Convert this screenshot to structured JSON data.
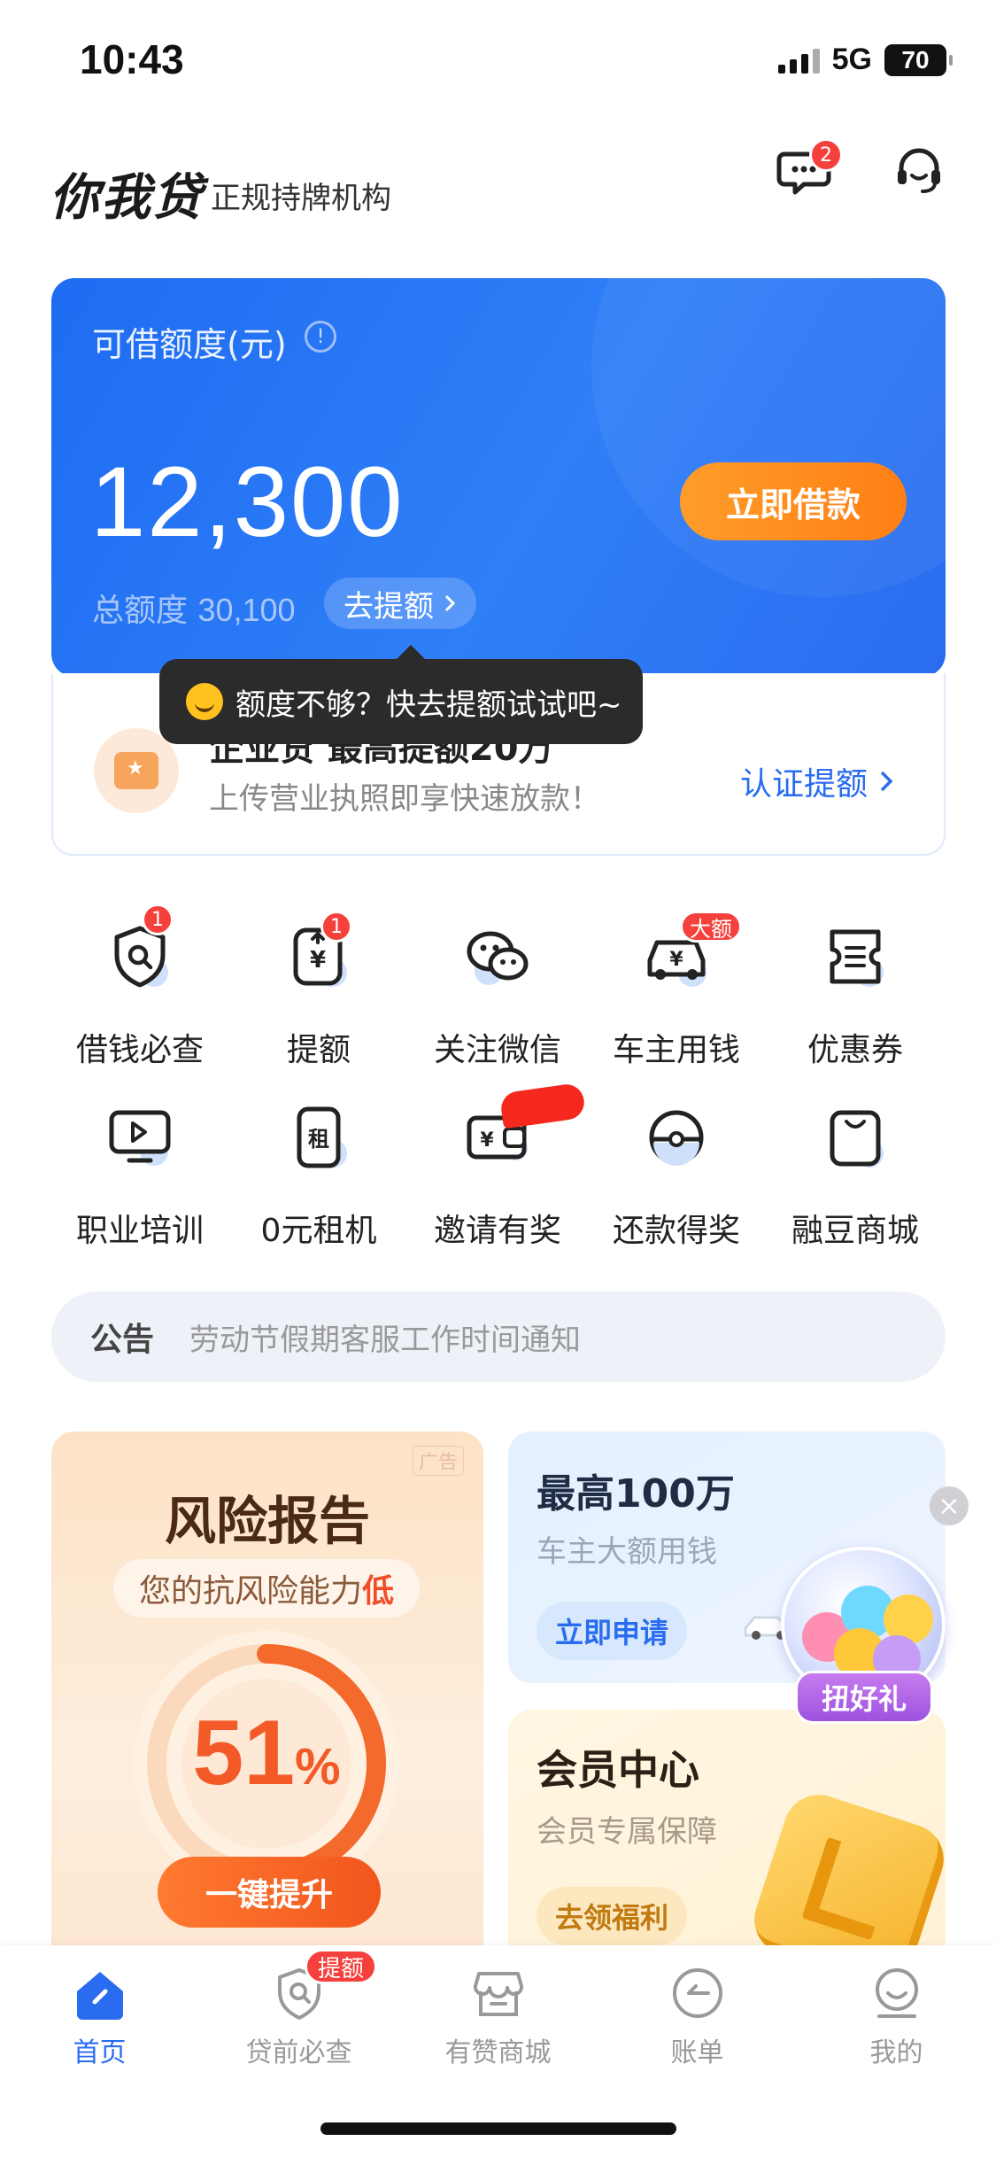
{
  "status_bar": {
    "time": "10:43",
    "network": "5G",
    "battery": "70"
  },
  "header": {
    "brand": "你我贷",
    "subtitle": "正规持牌机构",
    "message_badge": "2",
    "icons": {
      "messages": "chat-bubble-icon",
      "service": "headset-icon"
    }
  },
  "credit": {
    "label": "可借额度(元)",
    "amount": "12,300",
    "borrow_button": "立即借款",
    "total_label": "总额度",
    "total_value": "30,100",
    "raise_button": "去提额",
    "colors": {
      "card": "#2a6cf0",
      "button": "#ff8a1e"
    }
  },
  "tooltip": {
    "text": "额度不够？快去提额试试吧~"
  },
  "enterprise": {
    "title": "企业贷 最高提额20万",
    "subtitle": "上传营业执照即享快速放款！",
    "link": "认证提额"
  },
  "grid": [
    {
      "label": "借钱必查",
      "icon": "shield-search-icon",
      "badge": "1"
    },
    {
      "label": "提额",
      "icon": "yen-up-icon",
      "badge": "1"
    },
    {
      "label": "关注微信",
      "icon": "wechat-icon",
      "badge": ""
    },
    {
      "label": "车主用钱",
      "icon": "car-yen-icon",
      "badge": "大额"
    },
    {
      "label": "优惠券",
      "icon": "coupon-icon",
      "badge": ""
    },
    {
      "label": "职业培训",
      "icon": "video-board-icon",
      "badge": ""
    },
    {
      "label": "0元租机",
      "icon": "phone-rent-icon",
      "badge": ""
    },
    {
      "label": "邀请有奖",
      "icon": "wallet-yen-icon",
      "badge": ""
    },
    {
      "label": "还款得奖",
      "icon": "ball-icon",
      "badge": ""
    },
    {
      "label": "融豆商城",
      "icon": "shopping-bag-icon",
      "badge": ""
    }
  ],
  "notice": {
    "tag": "公告",
    "text": "劳动节假期客服工作时间通知"
  },
  "risk_card": {
    "ad": "广告",
    "title": "风险报告",
    "pill_prefix": "您的抗风险能力",
    "pill_level": "低",
    "percent": "51",
    "percent_unit": "%",
    "gauge_fraction": 0.51,
    "button": "一键提升"
  },
  "car_card": {
    "title": "最高100万",
    "subtitle": "车主大额用钱",
    "button": "立即申请"
  },
  "vip_card": {
    "title": "会员中心",
    "subtitle": "会员专属保障",
    "button": "去领福利"
  },
  "gift": {
    "label": "扭好礼",
    "close": "×"
  },
  "tabbar": [
    {
      "label": "首页",
      "icon": "home-icon",
      "active": true
    },
    {
      "label": "贷前必查",
      "icon": "shield-search-icon",
      "badge": "提额"
    },
    {
      "label": "有赞商城",
      "icon": "store-icon"
    },
    {
      "label": "账单",
      "icon": "bill-icon"
    },
    {
      "label": "我的",
      "icon": "profile-icon"
    }
  ]
}
